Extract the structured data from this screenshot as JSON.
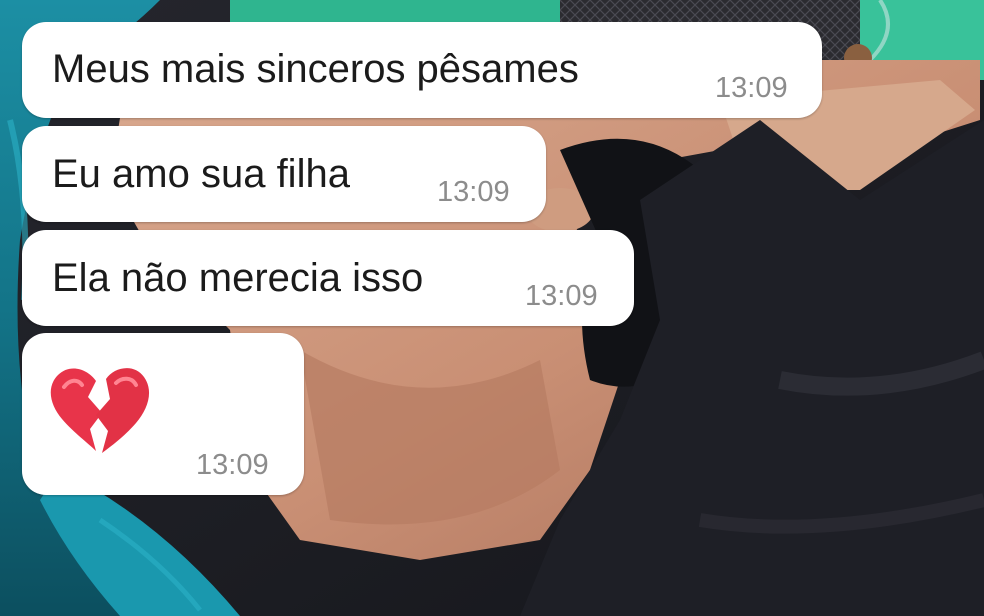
{
  "chat": {
    "messages": [
      {
        "text": "Meus mais sinceros pêsames",
        "time": "13:09"
      },
      {
        "text": "Eu amo sua filha",
        "time": "13:09"
      },
      {
        "text": "Ela não merecia isso",
        "time": "13:09"
      },
      {
        "emoji": "broken-heart-icon",
        "time": "13:09"
      }
    ]
  },
  "colors": {
    "bubble": "#ffffff",
    "message_text": "#1b1b1b",
    "timestamp": "#8c8c8c",
    "broken_heart": "#e8344a"
  }
}
